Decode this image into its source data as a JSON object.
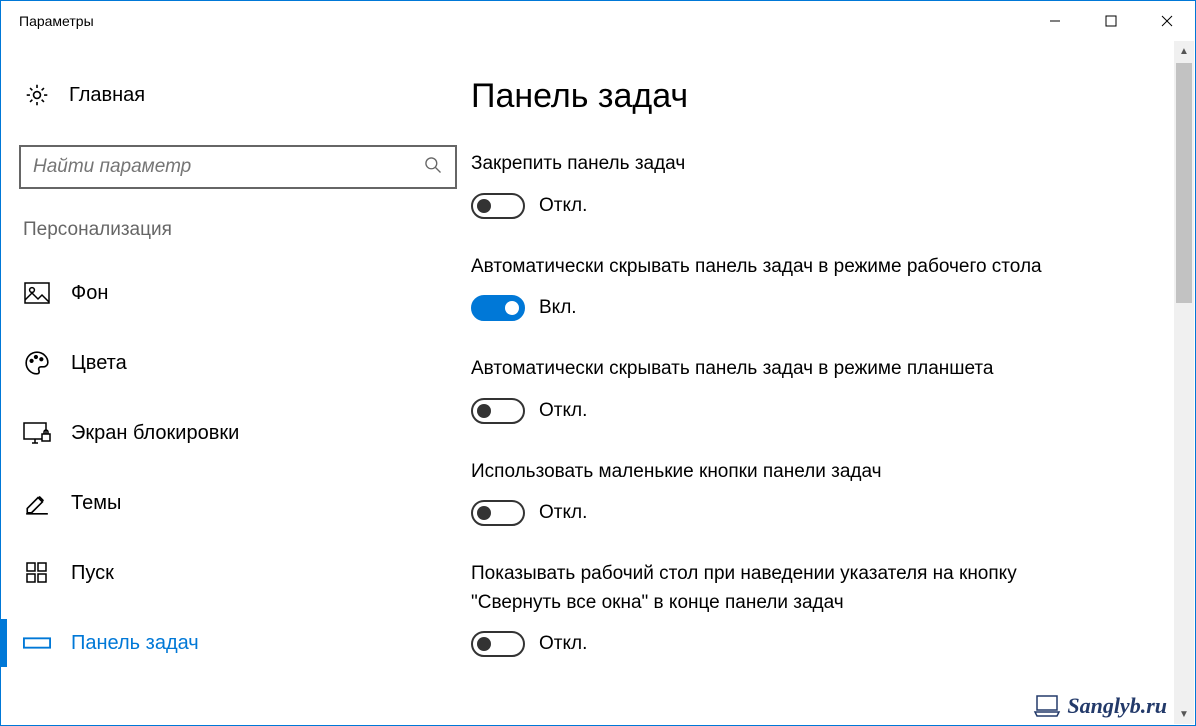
{
  "window": {
    "title": "Параметры"
  },
  "sidebar": {
    "home": "Главная",
    "search_placeholder": "Найти параметр",
    "section": "Персонализация",
    "items": [
      {
        "label": "Фон"
      },
      {
        "label": "Цвета"
      },
      {
        "label": "Экран блокировки"
      },
      {
        "label": "Темы"
      },
      {
        "label": "Пуск"
      },
      {
        "label": "Панель задач"
      }
    ]
  },
  "main": {
    "title": "Панель задач",
    "settings": [
      {
        "label": "Закрепить панель задач",
        "on": false,
        "state": "Откл."
      },
      {
        "label": "Автоматически скрывать панель задач в режиме рабочего стола",
        "on": true,
        "state": "Вкл."
      },
      {
        "label": "Автоматически скрывать панель задач в режиме планшета",
        "on": false,
        "state": "Откл."
      },
      {
        "label": "Использовать маленькие кнопки панели задач",
        "on": false,
        "state": "Откл."
      },
      {
        "label": "Показывать рабочий стол при наведении указателя на кнопку \"Свернуть все окна\" в конце панели задач",
        "on": false,
        "state": "Откл."
      }
    ]
  },
  "watermark": "Sanglyb.ru"
}
